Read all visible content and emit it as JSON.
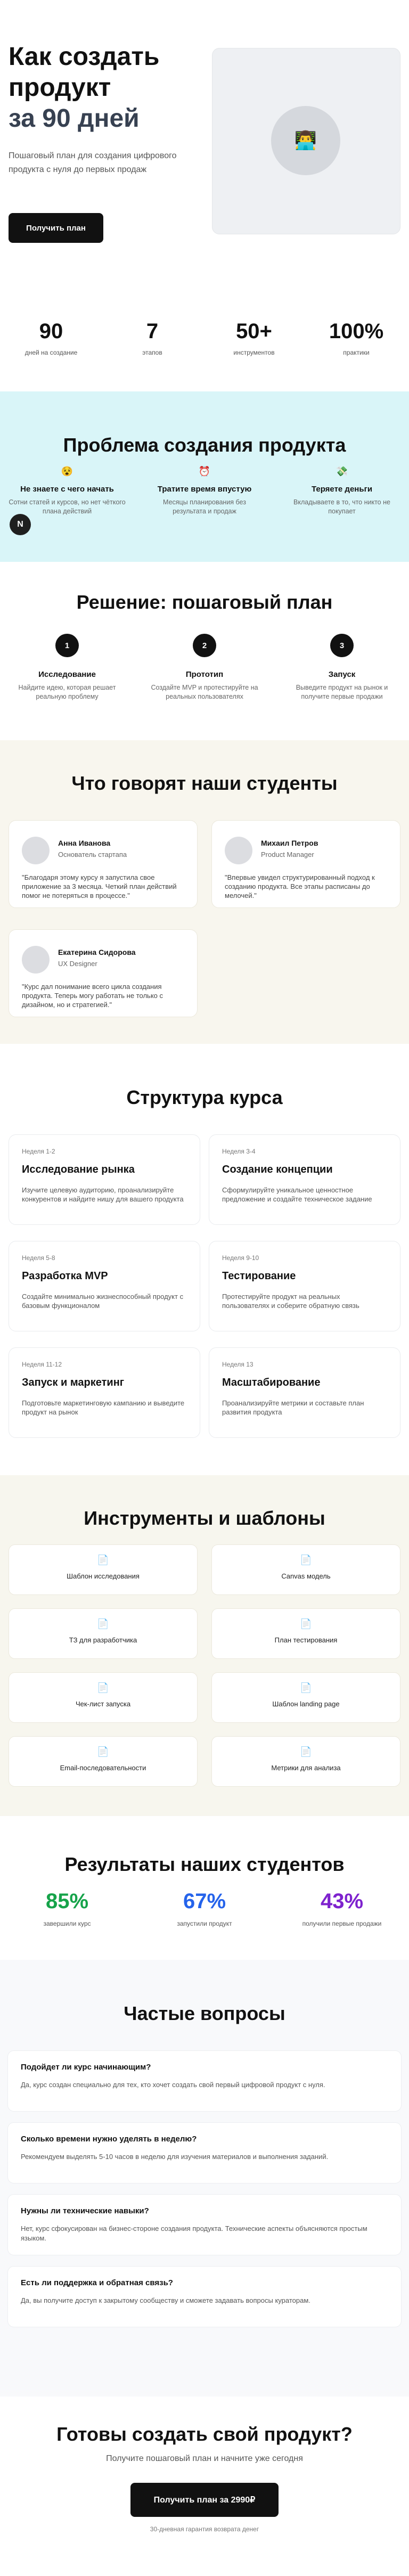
{
  "hero": {
    "title_line1": "Как создать",
    "title_line2": "продукт",
    "title_accent": "за 90 дней",
    "subtitle": "Пошаговый план для создания цифрового продукта с нуля до первых продаж",
    "cta_label": "Получить план",
    "image_emoji": "👨‍💻"
  },
  "stats": [
    {
      "value": "90",
      "label": "дней на создание"
    },
    {
      "value": "7",
      "label": "этапов"
    },
    {
      "value": "50+",
      "label": "инструментов"
    },
    {
      "value": "100%",
      "label": "практики"
    }
  ],
  "problem": {
    "title": "Проблема создания продукта",
    "items": [
      {
        "icon": "😵",
        "title": "Не знаете с чего начать",
        "desc": "Сотни статей и курсов, но нет чёткого плана действий"
      },
      {
        "icon": "⏰",
        "title": "Тратите время впустую",
        "desc": "Месяцы планирования без результата и продаж"
      },
      {
        "icon": "💸",
        "title": "Теряете деньги",
        "desc": "Вкладываете в то, что никто не покупает"
      }
    ],
    "badge_letter": "N"
  },
  "solution": {
    "title": "Решение: пошаговый план",
    "steps": [
      {
        "num": "1",
        "title": "Исследование",
        "desc": "Найдите идею, которая решает реальную проблему"
      },
      {
        "num": "2",
        "title": "Прототип",
        "desc": "Создайте MVP и протестируйте на реальных пользователях"
      },
      {
        "num": "3",
        "title": "Запуск",
        "desc": "Выведите продукт на рынок и получите первые продажи"
      }
    ]
  },
  "testimonials": {
    "title": "Что говорят наши студенты",
    "items": [
      {
        "name": "Анна Иванова",
        "role": "Основатель стартапа",
        "quote": "\"Благодаря этому курсу я запустила свое приложение за 3 месяца. Четкий план действий помог не потеряться в процессе.\""
      },
      {
        "name": "Михаил Петров",
        "role": "Product Manager",
        "quote": "\"Впервые увидел структурированный подход к созданию продукта. Все этапы расписаны до мелочей.\""
      },
      {
        "name": "Екатерина Сидорова",
        "role": "UX Designer",
        "quote": "\"Курс дал понимание всего цикла создания продукта. Теперь могу работать не только с дизайном, но и стратегией.\""
      }
    ]
  },
  "course": {
    "title": "Структура курса",
    "modules": [
      {
        "weeks": "Неделя 1-2",
        "title": "Исследование рынка",
        "desc": "Изучите целевую аудиторию, проанализируйте конкурентов и найдите нишу для вашего продукта"
      },
      {
        "weeks": "Неделя 3-4",
        "title": "Создание концепции",
        "desc": "Сформулируйте уникальное ценностное предложение и создайте техническое задание"
      },
      {
        "weeks": "Неделя 5-8",
        "title": "Разработка MVP",
        "desc": "Создайте минимально жизнеспособный продукт с базовым функционалом"
      },
      {
        "weeks": "Неделя 9-10",
        "title": "Тестирование",
        "desc": "Протестируйте продукт на реальных пользователях и соберите обратную связь"
      },
      {
        "weeks": "Неделя 11-12",
        "title": "Запуск и маркетинг",
        "desc": "Подготовьте маркетинговую кампанию и выведите продукт на рынок"
      },
      {
        "weeks": "Неделя 13",
        "title": "Масштабирование",
        "desc": "Проанализируйте метрики и составьте план развития продукта"
      }
    ]
  },
  "tools": {
    "title": "Инструменты и шаблоны",
    "icon": "📄",
    "items": [
      "Шаблон исследования",
      "Canvas модель",
      "ТЗ для разработчика",
      "План тестирования",
      "Чек-лист запуска",
      "Шаблон landing page",
      "Email-последовательности",
      "Метрики для анализа"
    ]
  },
  "results": {
    "title": "Результаты наших студентов",
    "items": [
      {
        "value": "85%",
        "label": "завершили курс",
        "color": "#16a34a"
      },
      {
        "value": "67%",
        "label": "запустили продукт",
        "color": "#2563eb"
      },
      {
        "value": "43%",
        "label": "получили первые продажи",
        "color": "#7e22ce"
      }
    ]
  },
  "faq": {
    "title": "Частые вопросы",
    "items": [
      {
        "q": "Подойдет ли курс начинающим?",
        "a": "Да, курс создан специально для тех, кто хочет создать свой первый цифровой продукт с нуля."
      },
      {
        "q": "Сколько времени нужно уделять в неделю?",
        "a": "Рекомендуем выделять 5-10 часов в неделю для изучения материалов и выполнения заданий."
      },
      {
        "q": "Нужны ли технические навыки?",
        "a": "Нет, курс сфокусирован на бизнес-стороне создания продукта. Технические аспекты объясняются простым языком."
      },
      {
        "q": "Есть ли поддержка и обратная связь?",
        "a": "Да, вы получите доступ к закрытому сообществу и сможете задавать вопросы кураторам."
      }
    ]
  },
  "cta": {
    "title": "Готовы создать свой продукт?",
    "subtitle": "Получите пошаговый план и начните уже сегодня",
    "button": "Получить план за 2990₽",
    "note": "30-дневная гарантия возврата денег"
  }
}
